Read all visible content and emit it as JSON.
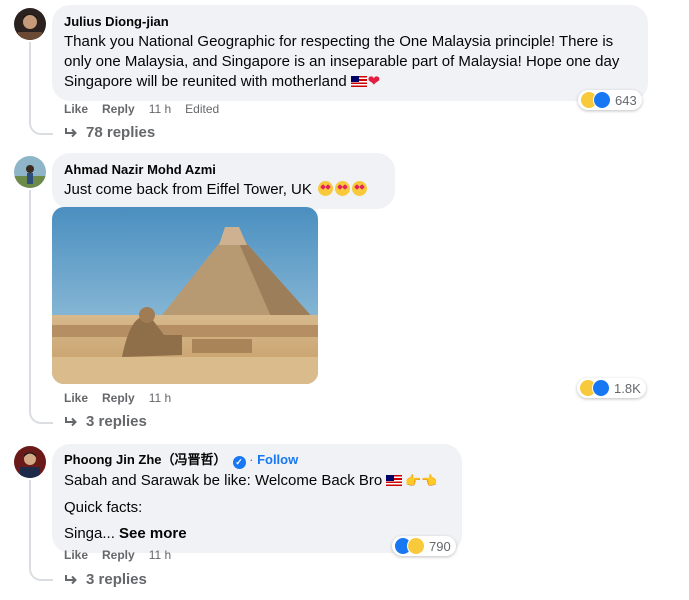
{
  "comments": [
    {
      "author": "Julius Diong-jian",
      "text": "Thank you National Geographic for respecting the One Malaysia principle! There is only one Malaysia, and Singapore is an inseparable part of Malaysia! Hope one day Singapore will be reunited with motherland",
      "actions": {
        "like": "Like",
        "reply": "Reply",
        "time": "11 h",
        "edited": "Edited"
      },
      "reaction_count": "643",
      "replies_label": "78 replies"
    },
    {
      "author": "Ahmad Nazir Mohd Azmi",
      "text": "Just come back from Eiffel Tower, UK",
      "actions": {
        "like": "Like",
        "reply": "Reply",
        "time": "11 h"
      },
      "reaction_count": "1.8K",
      "replies_label": "3 replies"
    },
    {
      "author": "Phoong Jin Zhe（冯晋哲）",
      "follow": "Follow",
      "text_line1": "Sabah and Sarawak be like: Welcome Back Bro",
      "text_line2": "Quick facts:",
      "text_line3": "Singa...",
      "see_more": "See more",
      "actions": {
        "like": "Like",
        "reply": "Reply",
        "time": "11 h"
      },
      "reaction_count": "790",
      "replies_label": "3 replies"
    }
  ],
  "icons": {
    "reply_arrow": "reply-arrow-icon",
    "haha": "haha-reaction-icon",
    "like": "like-reaction-icon",
    "verified": "verified-badge-icon"
  }
}
